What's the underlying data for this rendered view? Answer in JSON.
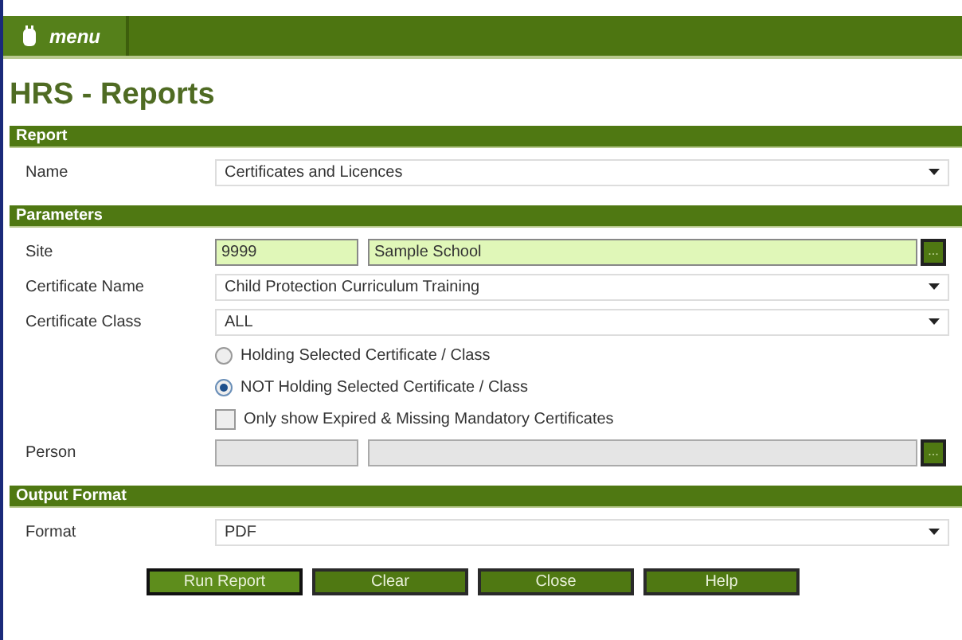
{
  "menu_bar": {
    "label": "menu"
  },
  "title": "HRS - Reports",
  "sections": [
    {
      "header": "Report",
      "fields": [
        {
          "kind": "dropdown",
          "label": "Name",
          "value": "Certificates and Licences"
        }
      ]
    },
    {
      "header": "Parameters",
      "fields": [
        {
          "kind": "lookup",
          "label": "Site",
          "code": "9999",
          "value": "Sample School",
          "highlighted": true,
          "button": "..."
        },
        {
          "kind": "dropdown",
          "label": "Certificate Name",
          "value": "Child Protection Curriculum Training"
        },
        {
          "kind": "dropdown",
          "label": "Certificate Class",
          "value": "ALL"
        },
        {
          "kind": "radio",
          "text": "Holding Selected Certificate / Class",
          "selected": false
        },
        {
          "kind": "radio",
          "text": "NOT Holding Selected Certificate / Class",
          "selected": true
        },
        {
          "kind": "checkbox",
          "text": "Only show Expired & Missing Mandatory Certificates",
          "checked": false
        },
        {
          "kind": "lookup",
          "label": "Person",
          "highlighted": false,
          "button": "..."
        }
      ]
    },
    {
      "header": "Output Format",
      "fields": [
        {
          "kind": "dropdown",
          "label": "Format",
          "value": "PDF"
        }
      ]
    }
  ],
  "buttons": [
    {
      "label": "Run Report",
      "selected": true
    },
    {
      "label": "Clear",
      "selected": false
    },
    {
      "label": "Close",
      "selected": false
    },
    {
      "label": "Help",
      "selected": false
    }
  ]
}
